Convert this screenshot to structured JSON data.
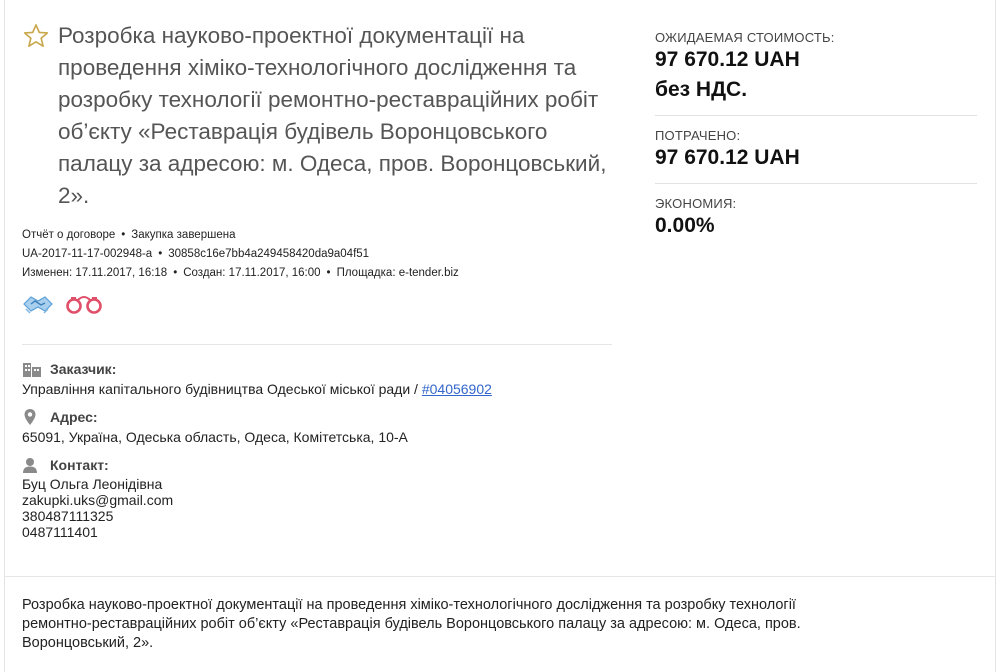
{
  "tender": {
    "title": "Розробка науково-проектної документації на проведення хіміко-технологічного дослідження та розробку технології ремонтно-реставраційних робіт об’єкту «Реставрація будівель Воронцовського палацу за адресою: м. Одеса, пров. Воронцовський, 2».",
    "meta": {
      "report_link": "Отчёт о договоре",
      "status": "Закупка завершена",
      "id": "UA-2017-11-17-002948-a",
      "hash": "30858c16e7bb4a249458420da9a04f51",
      "modified": "Изменен: 17.11.2017, 16:18",
      "created": "Создан: 17.11.2017, 16:00",
      "platform": "Площадка: e-tender.biz"
    }
  },
  "customer": {
    "label": "Заказчик:",
    "name": "Управління капітального будівництва Одеської міської ради /",
    "code_link": "#04056902"
  },
  "address": {
    "label": "Адрес:",
    "value": "65091, Україна, Одеська область, Одеса, Комітетська, 10-А"
  },
  "contact": {
    "label": "Контакт:",
    "name": "Буц Ольга Леонідівна",
    "email": "zakupki.uks@gmail.com",
    "phone1": "380487111325",
    "phone2": "0487111401"
  },
  "description": "Розробка науково-проектної документації на проведення хіміко-технологічного дослідження та розробку технології ремонтно-реставраційних робіт об’єкту «Реставрація будівель Воронцовського палацу за адресою: м. Одеса, пров. Воронцовський, 2».",
  "stats": {
    "expected_label": "ОЖИДАЕМАЯ СТОИМОСТЬ:",
    "expected_value": "97 670.12 UAH",
    "expected_vat": "без НДС.",
    "spent_label": "ПОТРАЧЕНО:",
    "spent_value": "97 670.12 UAH",
    "economy_label": "ЭКОНОМИЯ:",
    "economy_value": "0.00%"
  },
  "colors": {
    "star": "#c8a84a",
    "link": "#3366cc",
    "handcuffs": "#e0506a",
    "handshake": "#5aa0d8"
  },
  "icons": [
    "star-icon",
    "handshake-icon",
    "handcuffs-icon",
    "building-icon",
    "location-pin-icon",
    "person-icon"
  ]
}
